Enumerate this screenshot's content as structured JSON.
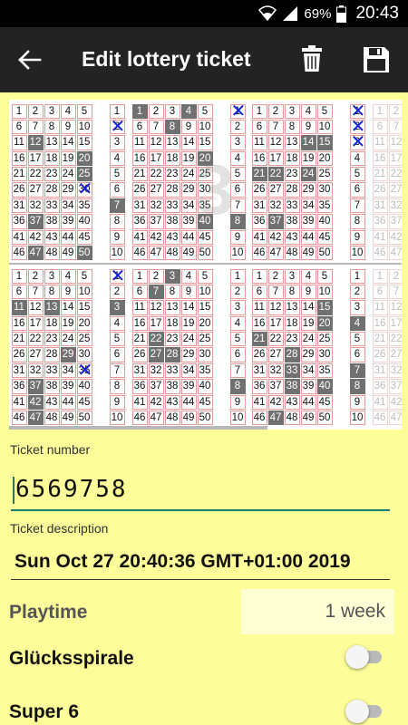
{
  "status_bar": {
    "battery": "69%",
    "time": "20:43"
  },
  "app_bar": {
    "title": "Edit lottery ticket"
  },
  "ticket": {
    "field_numbers": [
      "1",
      "2",
      "3",
      "4",
      "5",
      "6",
      "7",
      "8",
      "9",
      "10",
      "11",
      "12",
      "13",
      "14",
      "15",
      "16",
      "17",
      "18",
      "19",
      "20",
      "21",
      "22",
      "23",
      "24",
      "25",
      "26",
      "27",
      "28",
      "29",
      "30",
      "31",
      "32",
      "33",
      "34",
      "35",
      "36",
      "37",
      "38",
      "39",
      "40",
      "41",
      "42",
      "43",
      "44",
      "45",
      "46",
      "47",
      "48",
      "49",
      "50"
    ],
    "side_numbers": [
      "1",
      "2",
      "3",
      "4",
      "5",
      "6",
      "7",
      "8",
      "9",
      "10"
    ],
    "fields": [
      {
        "selected": [
          12,
          20,
          25,
          37,
          47,
          50
        ],
        "crossed": [
          30
        ],
        "side_selected": [
          7
        ],
        "side_crossed": [
          2
        ],
        "watermark": ""
      },
      {
        "selected": [
          1,
          4,
          8,
          20,
          40
        ],
        "crossed": [],
        "side_selected": [
          8
        ],
        "side_crossed": [
          1
        ],
        "watermark": "3"
      },
      {
        "selected": [
          14,
          15,
          21,
          22,
          24,
          37
        ],
        "crossed": [],
        "side_selected": [],
        "side_crossed": [
          1,
          2,
          3
        ],
        "watermark": ""
      },
      {
        "selected": [
          11,
          13,
          29,
          37,
          42,
          47
        ],
        "crossed": [
          35
        ],
        "side_selected": [
          3
        ],
        "side_crossed": [
          1
        ],
        "watermark": ""
      },
      {
        "selected": [
          3,
          7,
          22,
          27,
          28
        ],
        "crossed": [],
        "side_selected": [
          8
        ],
        "side_crossed": [],
        "watermark": ""
      },
      {
        "selected": [
          15,
          20,
          21,
          28,
          33,
          38,
          40,
          47
        ],
        "crossed": [],
        "side_selected": [
          4,
          7,
          8
        ],
        "side_crossed": [],
        "watermark": ""
      }
    ]
  },
  "form": {
    "ticket_number_label": "Ticket number",
    "ticket_number_value": "6569758",
    "ticket_description_label": "Ticket description",
    "ticket_description_value": "Sun Oct 27 20:40:36 GMT+01:00 2019",
    "playtime_label": "Playtime",
    "playtime_value": "1 week",
    "gluecksspirale_label": "Glücksspirale",
    "gluecksspirale_on": false,
    "super6_label": "Super 6",
    "super6_on": false
  },
  "colors": {
    "background": "#fdfd99",
    "app_bar": "#232323",
    "selected_cell": "#707070",
    "cross": "#1420d8",
    "accent": "#1a7b6f"
  }
}
